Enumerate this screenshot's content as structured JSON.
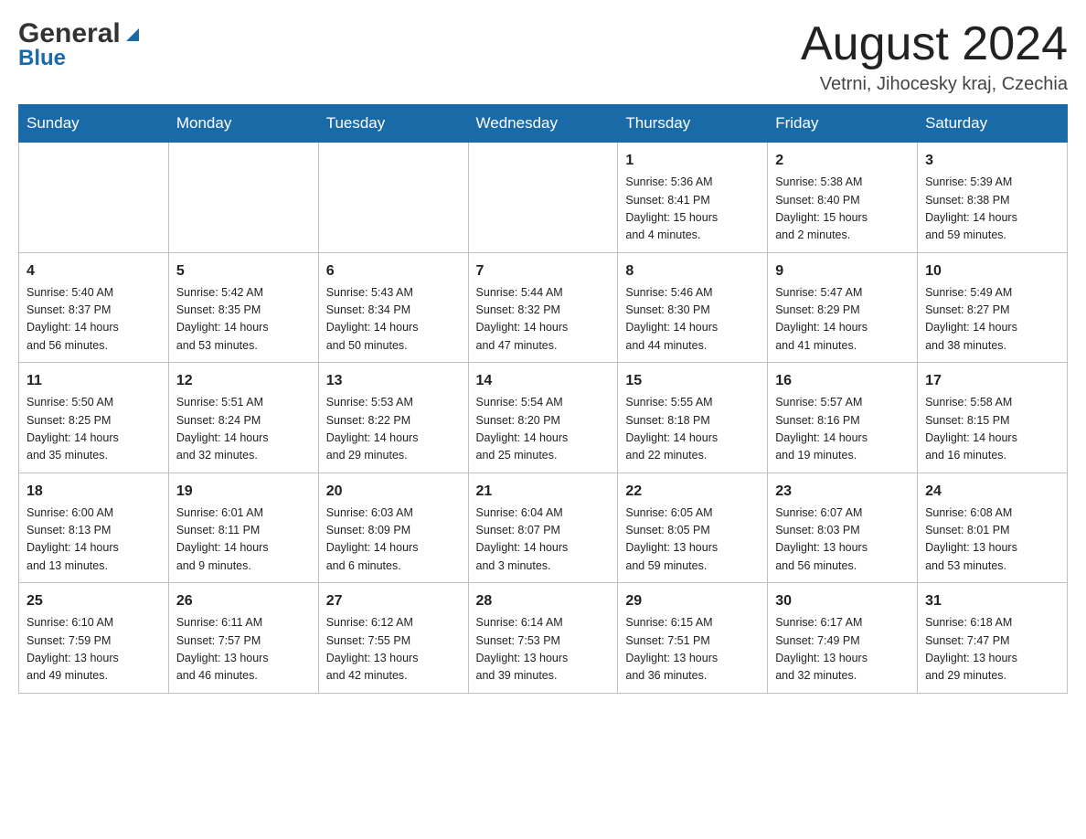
{
  "logo": {
    "general": "General",
    "blue": "Blue"
  },
  "header": {
    "month_title": "August 2024",
    "location": "Vetrni, Jihocesky kraj, Czechia"
  },
  "weekdays": [
    "Sunday",
    "Monday",
    "Tuesday",
    "Wednesday",
    "Thursday",
    "Friday",
    "Saturday"
  ],
  "weeks": [
    [
      {
        "day": "",
        "info": ""
      },
      {
        "day": "",
        "info": ""
      },
      {
        "day": "",
        "info": ""
      },
      {
        "day": "",
        "info": ""
      },
      {
        "day": "1",
        "info": "Sunrise: 5:36 AM\nSunset: 8:41 PM\nDaylight: 15 hours\nand 4 minutes."
      },
      {
        "day": "2",
        "info": "Sunrise: 5:38 AM\nSunset: 8:40 PM\nDaylight: 15 hours\nand 2 minutes."
      },
      {
        "day": "3",
        "info": "Sunrise: 5:39 AM\nSunset: 8:38 PM\nDaylight: 14 hours\nand 59 minutes."
      }
    ],
    [
      {
        "day": "4",
        "info": "Sunrise: 5:40 AM\nSunset: 8:37 PM\nDaylight: 14 hours\nand 56 minutes."
      },
      {
        "day": "5",
        "info": "Sunrise: 5:42 AM\nSunset: 8:35 PM\nDaylight: 14 hours\nand 53 minutes."
      },
      {
        "day": "6",
        "info": "Sunrise: 5:43 AM\nSunset: 8:34 PM\nDaylight: 14 hours\nand 50 minutes."
      },
      {
        "day": "7",
        "info": "Sunrise: 5:44 AM\nSunset: 8:32 PM\nDaylight: 14 hours\nand 47 minutes."
      },
      {
        "day": "8",
        "info": "Sunrise: 5:46 AM\nSunset: 8:30 PM\nDaylight: 14 hours\nand 44 minutes."
      },
      {
        "day": "9",
        "info": "Sunrise: 5:47 AM\nSunset: 8:29 PM\nDaylight: 14 hours\nand 41 minutes."
      },
      {
        "day": "10",
        "info": "Sunrise: 5:49 AM\nSunset: 8:27 PM\nDaylight: 14 hours\nand 38 minutes."
      }
    ],
    [
      {
        "day": "11",
        "info": "Sunrise: 5:50 AM\nSunset: 8:25 PM\nDaylight: 14 hours\nand 35 minutes."
      },
      {
        "day": "12",
        "info": "Sunrise: 5:51 AM\nSunset: 8:24 PM\nDaylight: 14 hours\nand 32 minutes."
      },
      {
        "day": "13",
        "info": "Sunrise: 5:53 AM\nSunset: 8:22 PM\nDaylight: 14 hours\nand 29 minutes."
      },
      {
        "day": "14",
        "info": "Sunrise: 5:54 AM\nSunset: 8:20 PM\nDaylight: 14 hours\nand 25 minutes."
      },
      {
        "day": "15",
        "info": "Sunrise: 5:55 AM\nSunset: 8:18 PM\nDaylight: 14 hours\nand 22 minutes."
      },
      {
        "day": "16",
        "info": "Sunrise: 5:57 AM\nSunset: 8:16 PM\nDaylight: 14 hours\nand 19 minutes."
      },
      {
        "day": "17",
        "info": "Sunrise: 5:58 AM\nSunset: 8:15 PM\nDaylight: 14 hours\nand 16 minutes."
      }
    ],
    [
      {
        "day": "18",
        "info": "Sunrise: 6:00 AM\nSunset: 8:13 PM\nDaylight: 14 hours\nand 13 minutes."
      },
      {
        "day": "19",
        "info": "Sunrise: 6:01 AM\nSunset: 8:11 PM\nDaylight: 14 hours\nand 9 minutes."
      },
      {
        "day": "20",
        "info": "Sunrise: 6:03 AM\nSunset: 8:09 PM\nDaylight: 14 hours\nand 6 minutes."
      },
      {
        "day": "21",
        "info": "Sunrise: 6:04 AM\nSunset: 8:07 PM\nDaylight: 14 hours\nand 3 minutes."
      },
      {
        "day": "22",
        "info": "Sunrise: 6:05 AM\nSunset: 8:05 PM\nDaylight: 13 hours\nand 59 minutes."
      },
      {
        "day": "23",
        "info": "Sunrise: 6:07 AM\nSunset: 8:03 PM\nDaylight: 13 hours\nand 56 minutes."
      },
      {
        "day": "24",
        "info": "Sunrise: 6:08 AM\nSunset: 8:01 PM\nDaylight: 13 hours\nand 53 minutes."
      }
    ],
    [
      {
        "day": "25",
        "info": "Sunrise: 6:10 AM\nSunset: 7:59 PM\nDaylight: 13 hours\nand 49 minutes."
      },
      {
        "day": "26",
        "info": "Sunrise: 6:11 AM\nSunset: 7:57 PM\nDaylight: 13 hours\nand 46 minutes."
      },
      {
        "day": "27",
        "info": "Sunrise: 6:12 AM\nSunset: 7:55 PM\nDaylight: 13 hours\nand 42 minutes."
      },
      {
        "day": "28",
        "info": "Sunrise: 6:14 AM\nSunset: 7:53 PM\nDaylight: 13 hours\nand 39 minutes."
      },
      {
        "day": "29",
        "info": "Sunrise: 6:15 AM\nSunset: 7:51 PM\nDaylight: 13 hours\nand 36 minutes."
      },
      {
        "day": "30",
        "info": "Sunrise: 6:17 AM\nSunset: 7:49 PM\nDaylight: 13 hours\nand 32 minutes."
      },
      {
        "day": "31",
        "info": "Sunrise: 6:18 AM\nSunset: 7:47 PM\nDaylight: 13 hours\nand 29 minutes."
      }
    ]
  ]
}
